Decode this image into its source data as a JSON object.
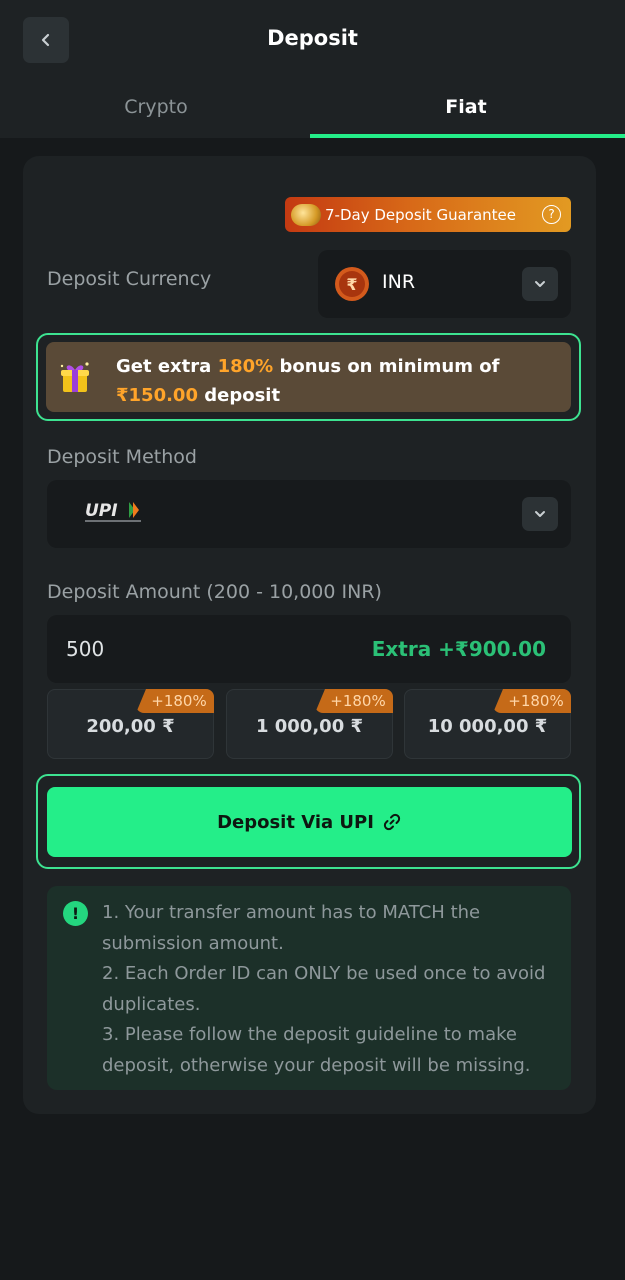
{
  "header": {
    "title": "Deposit",
    "back_icon": "chevron-left-icon"
  },
  "tabs": [
    {
      "label": "Crypto",
      "active": false
    },
    {
      "label": "Fiat",
      "active": true
    }
  ],
  "guarantee": {
    "label": "7-Day Deposit Guarantee",
    "help": "?"
  },
  "currency": {
    "label": "Deposit Currency",
    "symbol": "₹",
    "value": "INR"
  },
  "bonus": {
    "prefix": "Get extra ",
    "percent": "180%",
    "middle": " bonus on minimum of ",
    "minimum": "₹150.00",
    "suffix": " deposit"
  },
  "method": {
    "label": "Deposit Method",
    "value": "UPI"
  },
  "amount": {
    "label": "Deposit Amount (200 - 10,000 INR)",
    "value": "500",
    "extra": "Extra +₹900.00"
  },
  "presets": [
    {
      "badge": "+180%",
      "value": "200,00 ₹"
    },
    {
      "badge": "+180%",
      "value": "1 000,00 ₹"
    },
    {
      "badge": "+180%",
      "value": "10 000,00 ₹"
    }
  ],
  "deposit_button": {
    "label": "Deposit Via UPI"
  },
  "notice": {
    "icon": "!",
    "lines": [
      "1. Your transfer amount has to MATCH the submission amount.",
      "2. Each Order ID can ONLY be used once to avoid duplicates.",
      "3. Please follow the deposit guideline to make deposit, otherwise your deposit will be missing."
    ]
  },
  "colors": {
    "accent": "#24ee89",
    "bonus_highlight": "#ffa42a",
    "extra_green": "#2bc076",
    "background": "#16191b",
    "card": "#1e2224"
  }
}
